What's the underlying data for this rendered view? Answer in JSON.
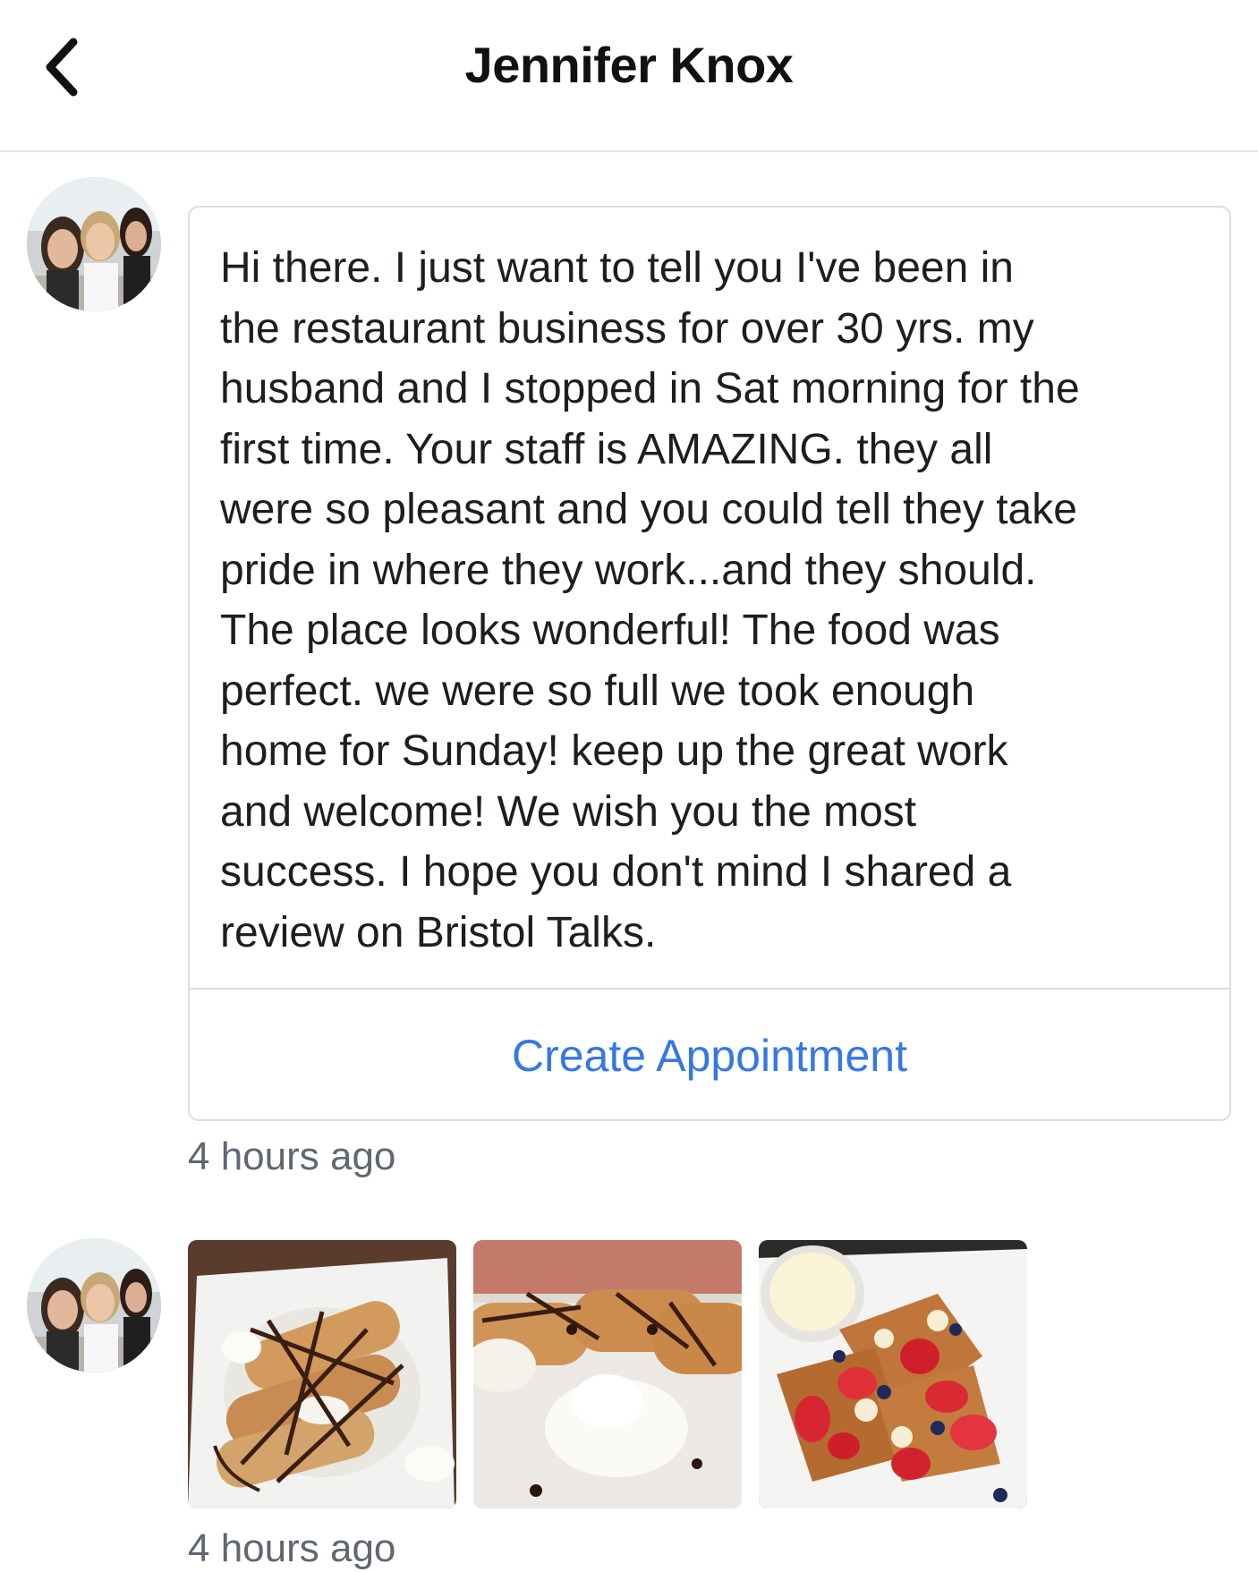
{
  "header": {
    "title": "Jennifer Knox",
    "back_icon": "chevron-left-icon"
  },
  "conversation": {
    "messages": [
      {
        "type": "text",
        "text": "Hi there. I just want to tell you I've been in\nthe restaurant business for over 30 yrs. my\nhusband and I stopped in Sat morning for the\nfirst time. Your staff is AMAZING. they all\nwere so pleasant and you could tell they take\npride in where they work...and they should.\nThe place looks wonderful! The food was\nperfect. we were so full we took enough\nhome for Sunday! keep up the great work\nand welcome! We wish you the most\nsuccess. I hope you don't mind I shared a\nreview on Bristol Talks.",
        "action_label": "Create Appointment",
        "timestamp": "4 hours ago"
      },
      {
        "type": "photos",
        "photos": [
          {
            "name": "crepes-with-chocolate-drizzle-photo"
          },
          {
            "name": "crepe-rolls-with-whipped-cream-photo"
          },
          {
            "name": "french-toast-with-berries-photo"
          }
        ],
        "timestamp": "4 hours ago"
      }
    ]
  },
  "colors": {
    "accent": "#3578e5",
    "border": "#dadde1",
    "muted_text": "#606770",
    "text": "#1c1e21"
  }
}
